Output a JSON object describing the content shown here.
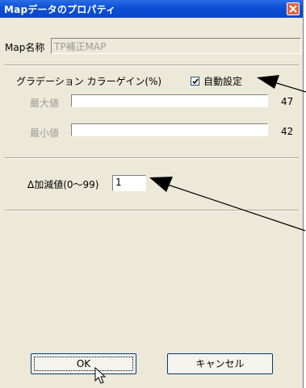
{
  "window": {
    "title": "Mapデータのプロパティ"
  },
  "map_name": {
    "label": "Map名称",
    "value": "TP補正MAP"
  },
  "gradation": {
    "label": "グラデーション カラーゲイン(%)",
    "auto_label": "自動設定",
    "auto_checked": true,
    "max_label": "最大値",
    "max_value": "47",
    "min_label": "最小値",
    "min_value": "42"
  },
  "delta": {
    "label": "Δ加減値(0〜99)",
    "value": "1"
  },
  "buttons": {
    "ok": "OK",
    "cancel": "キャンセル"
  },
  "colors": {
    "title_bar": "#0a4fd4",
    "dialog_bg": "#ece9d8",
    "close_button": "#e0623e"
  },
  "icons": [
    "close-icon",
    "checkmark-icon",
    "mouse-cursor-icon",
    "annotation-arrow"
  ]
}
